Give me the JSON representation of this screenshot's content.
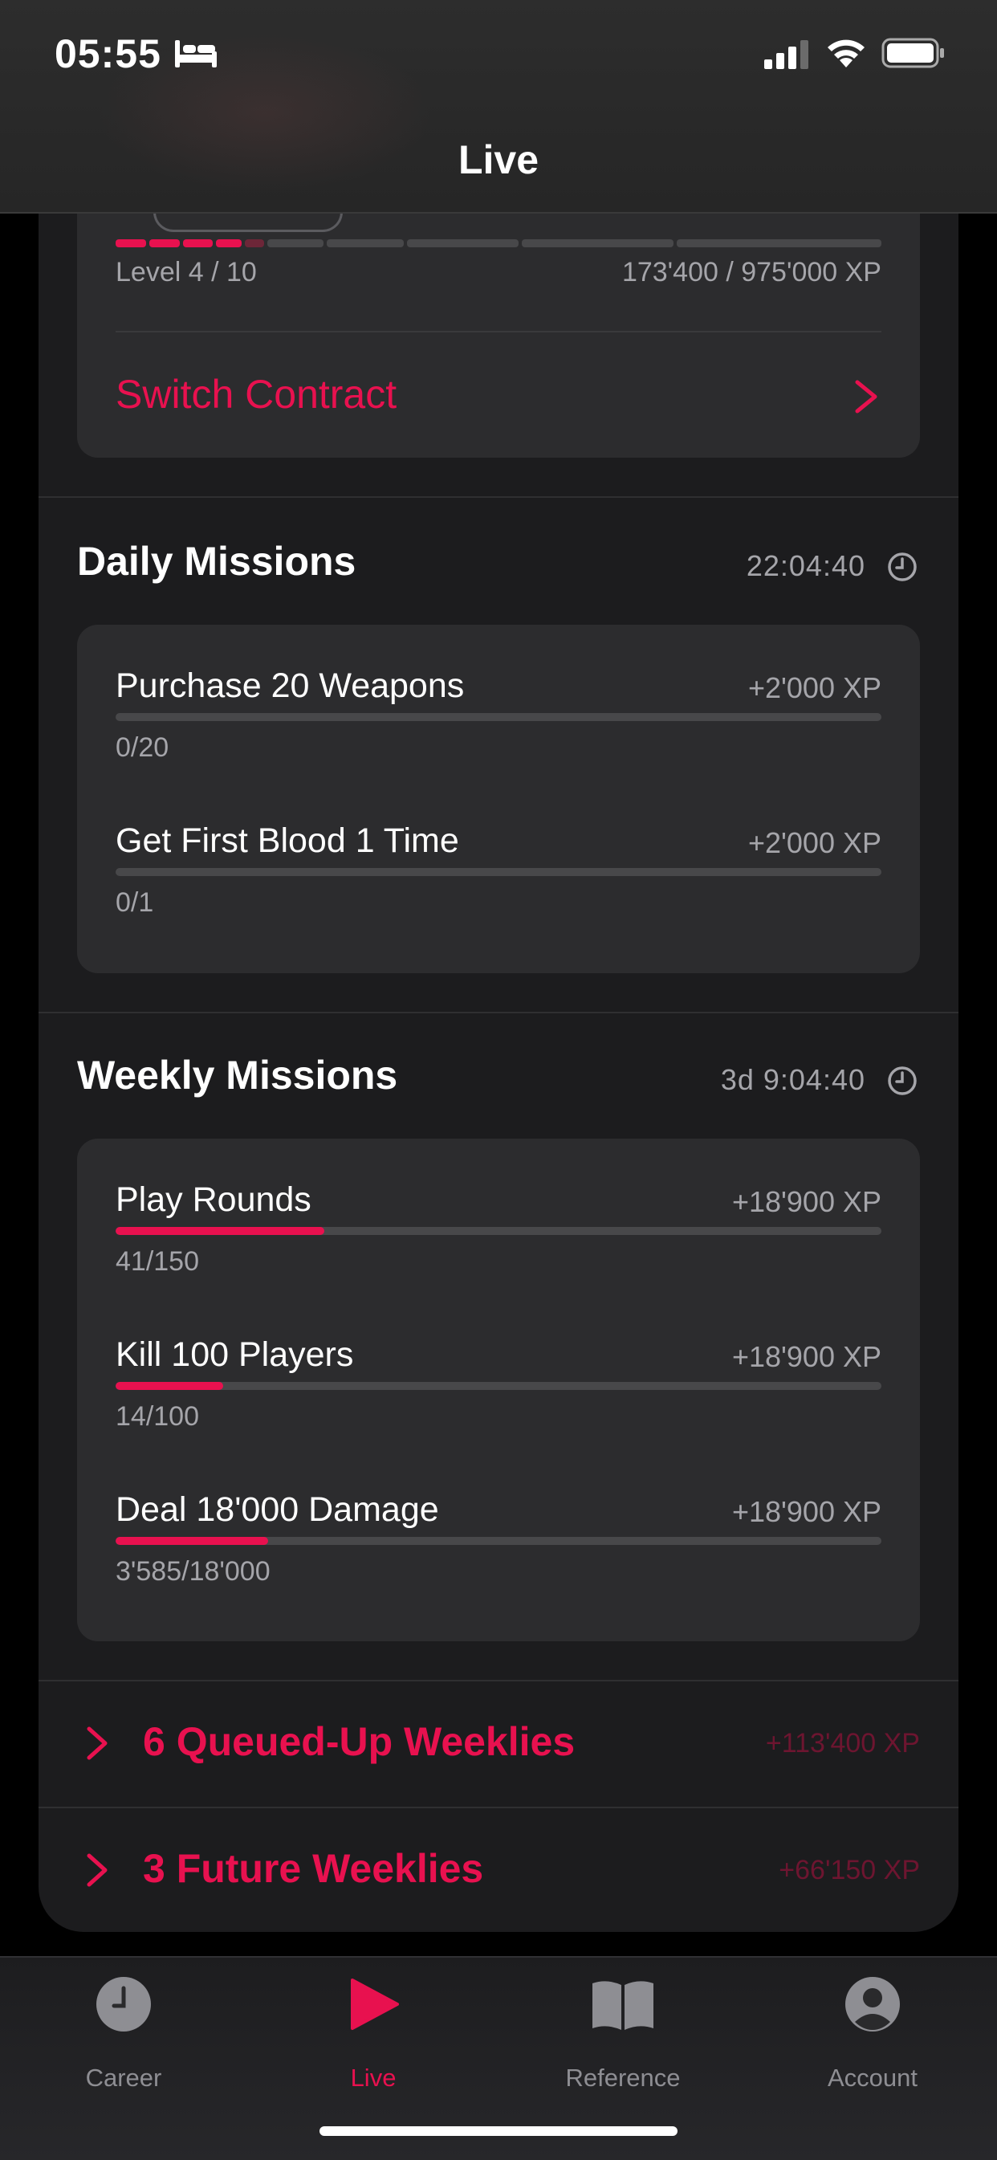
{
  "status_bar": {
    "time": "05:55"
  },
  "header": {
    "title": "Live"
  },
  "contract": {
    "level_text": "Level 4 / 10",
    "xp_text": "173'400 / 975'000 XP",
    "level_progress": 0.178,
    "switch_label": "Switch Contract"
  },
  "daily": {
    "title": "Daily Missions",
    "timer": "22:04:40",
    "missions": [
      {
        "title": "Purchase 20 Weapons",
        "xp": "+2'000 XP",
        "progress_text": "0/20",
        "progress": 0.0
      },
      {
        "title": "Get First Blood 1 Time",
        "xp": "+2'000 XP",
        "progress_text": "0/1",
        "progress": 0.0
      }
    ]
  },
  "weekly": {
    "title": "Weekly Missions",
    "timer": "3d 9:04:40",
    "missions": [
      {
        "title": "Play Rounds",
        "xp": "+18'900 XP",
        "progress_text": "41/150",
        "progress": 0.273
      },
      {
        "title": "Kill 100 Players",
        "xp": "+18'900 XP",
        "progress_text": "14/100",
        "progress": 0.14
      },
      {
        "title": "Deal 18'000 Damage",
        "xp": "+18'900 XP",
        "progress_text": "3'585/18'000",
        "progress": 0.199
      }
    ]
  },
  "queued": {
    "label": "6 Queued-Up Weeklies",
    "xp": "+113'400 XP"
  },
  "future": {
    "label": "3 Future Weeklies",
    "xp": "+66'150 XP"
  },
  "tabs": [
    {
      "label": "Career",
      "icon": "clock-icon"
    },
    {
      "label": "Live",
      "icon": "play-icon"
    },
    {
      "label": "Reference",
      "icon": "book-icon"
    },
    {
      "label": "Account",
      "icon": "person-circle-icon"
    }
  ],
  "active_tab": "Live",
  "accent_color": "#e8114f"
}
